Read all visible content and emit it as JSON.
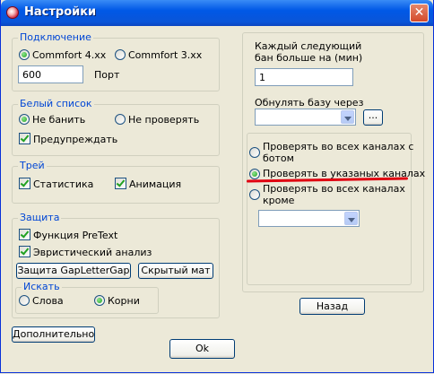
{
  "window": {
    "title": "Настройки",
    "close_glyph": "✕"
  },
  "connection": {
    "title": "Подключение",
    "options": [
      "Commfort 4.xx",
      "Commfort 3.xx"
    ],
    "selected": 0,
    "port_value": "600",
    "port_label": "Порт"
  },
  "whitelist": {
    "title": "Белый список",
    "no_ban": "Не банить",
    "no_check": "Не проверять",
    "warn": "Предупреждать"
  },
  "tray": {
    "title": "Трей",
    "stats": "Статистика",
    "animation": "Анимация"
  },
  "protection": {
    "title": "Защита",
    "pretext": "Функция  PreText",
    "heuristic": "Эвристический анализ",
    "gap_button": "Защита GapLetterGap",
    "hidden_mat_button": "Скрытый мат",
    "search": {
      "title": "Искать",
      "words": "Слова",
      "roots": "Корни"
    }
  },
  "right": {
    "ban_label_1": "Каждый следующий",
    "ban_label_2": "бан больше на (мин)",
    "ban_value": "1",
    "reset_label": "Обнулять базу  через",
    "reset_value": "",
    "browse_button": "...",
    "channels": {
      "all_with_bot_1": "Проверять во всех каналах с",
      "all_with_bot_2": "ботом",
      "specified": "Проверять в указаных каналах",
      "all_except_1": "Проверять во всех каналах",
      "all_except_2": "кроме",
      "except_value": ""
    },
    "back_button": "Назад"
  },
  "bottom": {
    "more_button": "Дополнительно",
    "ok_button": "Ok"
  },
  "colors": {
    "group_label": "#0046d5",
    "title_bar": "#0058e6",
    "annotation": "#e00010"
  }
}
